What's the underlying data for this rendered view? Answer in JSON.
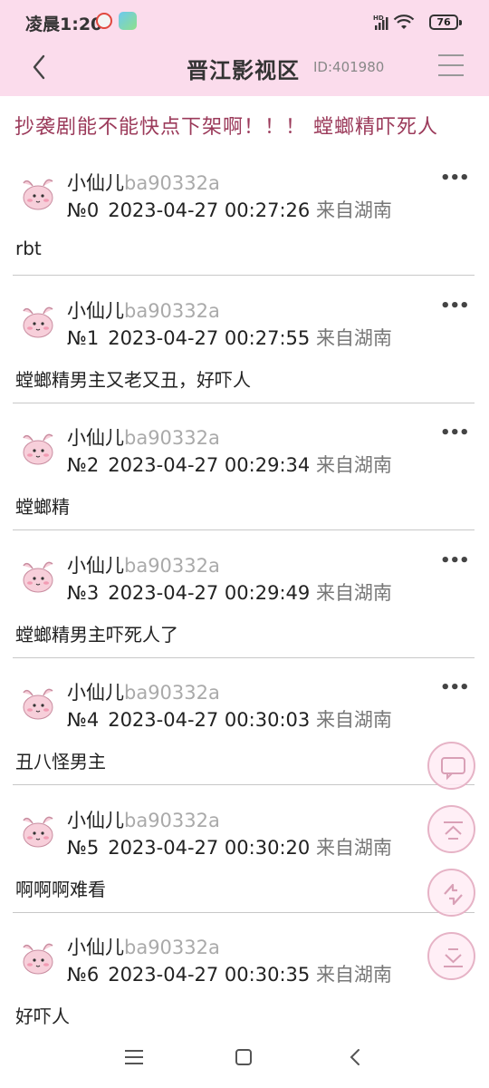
{
  "status_bar": {
    "time": "凌晨1:20",
    "battery": "76",
    "network_label": "HD"
  },
  "header": {
    "title": "晋江影视区",
    "id_label": "ID:401980"
  },
  "thread": {
    "title": "抄袭剧能不能快点下架啊！！！ 螳螂精吓死人"
  },
  "posts": [
    {
      "username": "小仙儿",
      "uid": "ba90332a",
      "no": "№0",
      "datetime": "2023-04-27 00:27:26",
      "location": "来自湖南",
      "content": "rbt",
      "more": "•••"
    },
    {
      "username": "小仙儿",
      "uid": "ba90332a",
      "no": "№1",
      "datetime": "2023-04-27 00:27:55",
      "location": "来自湖南",
      "content": "螳螂精男主又老又丑，好吓人",
      "more": "•••"
    },
    {
      "username": "小仙儿",
      "uid": "ba90332a",
      "no": "№2",
      "datetime": "2023-04-27 00:29:34",
      "location": "来自湖南",
      "content": "螳螂精",
      "more": "•••"
    },
    {
      "username": "小仙儿",
      "uid": "ba90332a",
      "no": "№3",
      "datetime": "2023-04-27 00:29:49",
      "location": "来自湖南",
      "content": "螳螂精男主吓死人了",
      "more": "•••"
    },
    {
      "username": "小仙儿",
      "uid": "ba90332a",
      "no": "№4",
      "datetime": "2023-04-27 00:30:03",
      "location": "来自湖南",
      "content": "丑八怪男主",
      "more": "•••"
    },
    {
      "username": "小仙儿",
      "uid": "ba90332a",
      "no": "№5",
      "datetime": "2023-04-27 00:30:20",
      "location": "来自湖南",
      "content": "啊啊啊难看",
      "more": ""
    },
    {
      "username": "小仙儿",
      "uid": "ba90332a",
      "no": "№6",
      "datetime": "2023-04-27 00:30:35",
      "location": "来自湖南",
      "content": "好吓人",
      "more": ""
    }
  ],
  "floating_buttons": [
    "comment-icon",
    "scroll-top-icon",
    "refresh-icon",
    "scroll-bottom-icon"
  ],
  "colors": {
    "header_bg": "#fbdcec",
    "title_color": "#9b3a5a",
    "fab_border": "#e6b3c6"
  }
}
